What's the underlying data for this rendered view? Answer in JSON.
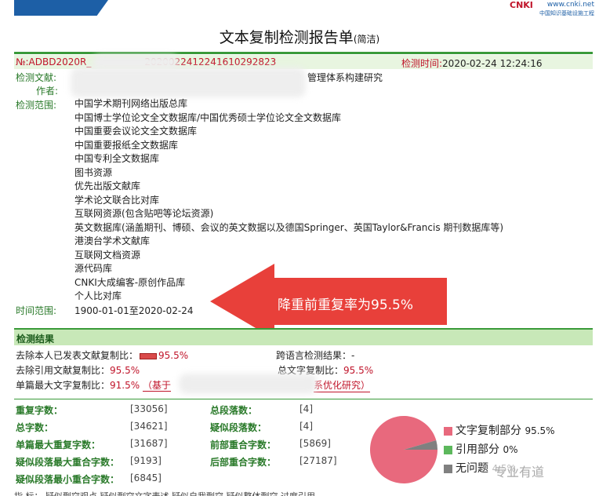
{
  "logo": {
    "cnki_text": "CNKI",
    "url": "www.cnki.net",
    "subtitle": "中国知识基础设施工程"
  },
  "title": {
    "main": "文本复制检测报告单",
    "suffix": "(简洁)"
  },
  "header": {
    "id_prefix": "№:ADBD2020R_",
    "id_suffix": "2020022412241610292823",
    "time_label": "检测时间:",
    "time_value": "2020-02-24 12:24:16"
  },
  "doc": {
    "label": "检测文献:",
    "title_tail": "管理体系构建研究",
    "author_label": "作者:",
    "scope_label": "检测范围:",
    "scope": [
      "中国学术期刊网络出版总库",
      "中国博士学位论文全文数据库/中国优秀硕士学位论文全文数据库",
      "中国重要会议论文全文数据库",
      "中国重要报纸全文数据库",
      "中国专利全文数据库",
      "图书资源",
      "优先出版文献库",
      "学术论文联合比对库",
      "互联网资源(包含贴吧等论坛资源)",
      "英文数据库(涵盖期刊、博硕、会议的英文数据以及德国Springer、英国Taylor&Francis 期刊数据库等)",
      "港澳台学术文献库",
      "互联网文档资源",
      "源代码库",
      "CNKI大成编客-原创作品库",
      "个人比对库"
    ],
    "time_range_label": "时间范围:",
    "time_range": "1900-01-01至2020-02-24"
  },
  "annotation": {
    "text": "降重前重复率为95.5%",
    "color": "#e8403a"
  },
  "results": {
    "heading": "检测结果",
    "self_label": "去除本人已发表文献复制比：",
    "self_value": "95.5%",
    "cross_label": "跨语言检测结果：",
    "cross_value": "-",
    "cite_label": "去除引用文献复制比：",
    "cite_value": "95.5%",
    "total_label": "总文字复制比：",
    "total_value": "95.5%",
    "max_label": "单篇最大文字复制比：",
    "max_value": "91.5%",
    "max_src_open": "（基于",
    "max_src_close": "系优化研究）"
  },
  "stats": {
    "rows": [
      {
        "l1": "重复字数：",
        "v1": "[33056]",
        "l2": "总段落数：",
        "v2": "[4]"
      },
      {
        "l1": "总字数：",
        "v1": "[34621]",
        "l2": "疑似段落数：",
        "v2": "[4]"
      },
      {
        "l1": "单篇最大重复字数：",
        "v1": "[31687]",
        "l2": "前部重合字数：",
        "v2": "[5869]"
      },
      {
        "l1": "疑似段落最大重合字数：",
        "v1": "[9193]",
        "l2": "后部重合字数：",
        "v2": "[27187]"
      },
      {
        "l1": "疑似段落最小重合字数：",
        "v1": "[6845]",
        "l2": "",
        "v2": ""
      }
    ]
  },
  "pie": {
    "colors": {
      "copy": "#e8697d",
      "cite": "#5cb85c",
      "ok": "#808080"
    },
    "legend": [
      {
        "label": "文字复制部分",
        "value": "95.5%"
      },
      {
        "label": "引用部分",
        "value": "0%"
      },
      {
        "label": "无问题",
        "value": "4.5%"
      }
    ],
    "fractions": {
      "copy": 0.955,
      "cite": 0.0,
      "ok": 0.045
    }
  },
  "footer": {
    "watermark": "专业有道",
    "row": "指  标： 疑似剽窃观点  疑似剽窃文字表述  疑似自我剽窃  疑似整体剽窃  过度引用"
  }
}
